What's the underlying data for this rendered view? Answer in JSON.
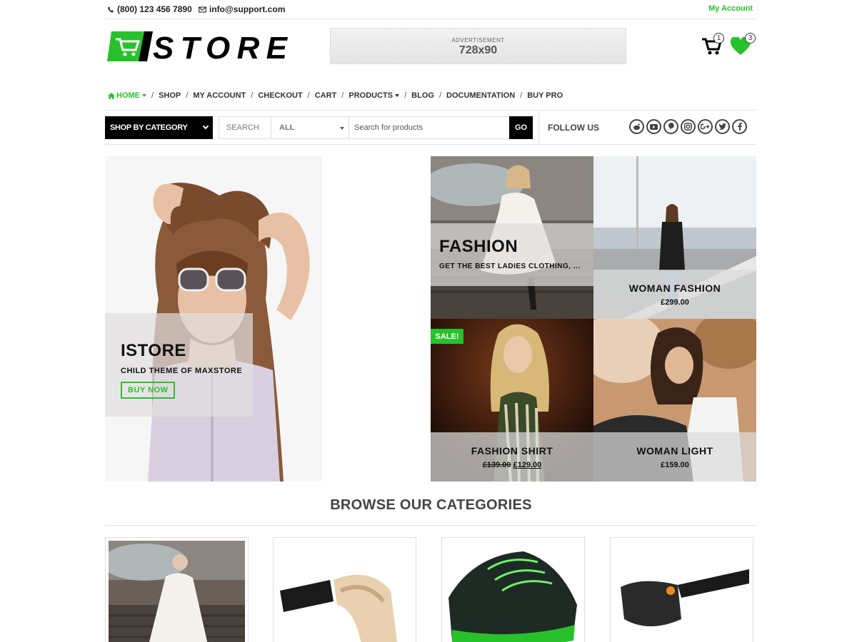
{
  "topbar": {
    "phone": "(800) 123 456 7890",
    "email": "info@support.com",
    "account": "My Account"
  },
  "header": {
    "logo_text": "iSTORE",
    "ad_label": "ADVERTISEMENT",
    "ad_size": "728x90",
    "cart_count": "1",
    "wishlist_count": "3"
  },
  "nav": {
    "items": [
      {
        "label": "HOME"
      },
      {
        "label": "SHOP"
      },
      {
        "label": "MY ACCOUNT"
      },
      {
        "label": "CHECKOUT"
      },
      {
        "label": "CART"
      },
      {
        "label": "PRODUCTS"
      },
      {
        "label": "BLOG"
      },
      {
        "label": "DOCUMENTATION"
      },
      {
        "label": "BUY PRO"
      }
    ],
    "separator": "/"
  },
  "search": {
    "category_button": "SHOP BY CATEGORY",
    "label": "SEARCH",
    "select_value": "ALL",
    "placeholder": "Search for products",
    "go": "GO",
    "follow_us": "FOLLOW US"
  },
  "hero": {
    "main": {
      "title": "ISTORE",
      "subtitle": "CHILD THEME OF MAXSTORE",
      "button": "BUY NOW"
    },
    "fashion": {
      "title": "FASHION",
      "subtitle": "GET THE BEST LADIES CLOTHING, ..."
    },
    "woman_fashion": {
      "name": "WOMAN FASHION",
      "price": "£299.00"
    },
    "fashion_shirt": {
      "name": "FASHION SHIRT",
      "old_price": "£139.00",
      "new_price": "£129.00",
      "sale": "SALE!"
    },
    "woman_light": {
      "name": "WOMAN LIGHT",
      "price": "£159.00"
    }
  },
  "categories": {
    "heading": "BROWSE OUR CATEGORIES"
  },
  "colors": {
    "accent": "#27c22b",
    "dark": "#000000"
  }
}
